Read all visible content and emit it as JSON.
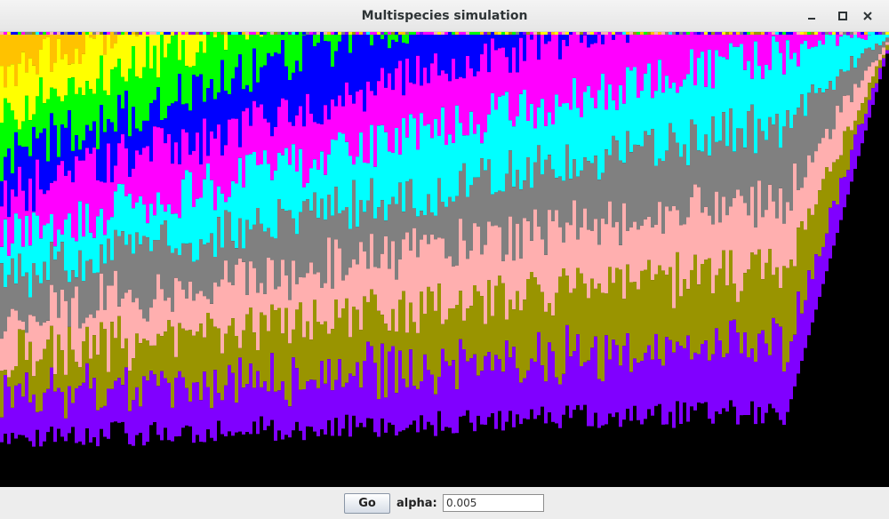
{
  "window": {
    "title": "Multispecies simulation",
    "controls": [
      "minimize-icon",
      "maximize-icon",
      "close-icon"
    ]
  },
  "simulation": {
    "background": "#000000",
    "species_colors": [
      "#ffc200",
      "#ffff00",
      "#00ff00",
      "#0000ff",
      "#ff00ff",
      "#00ffff",
      "#808080",
      "#ffafaf",
      "#999400",
      "#8000ff"
    ]
  },
  "controls": {
    "go_label": "Go",
    "alpha_label": "alpha:",
    "alpha_value": "0.005"
  }
}
